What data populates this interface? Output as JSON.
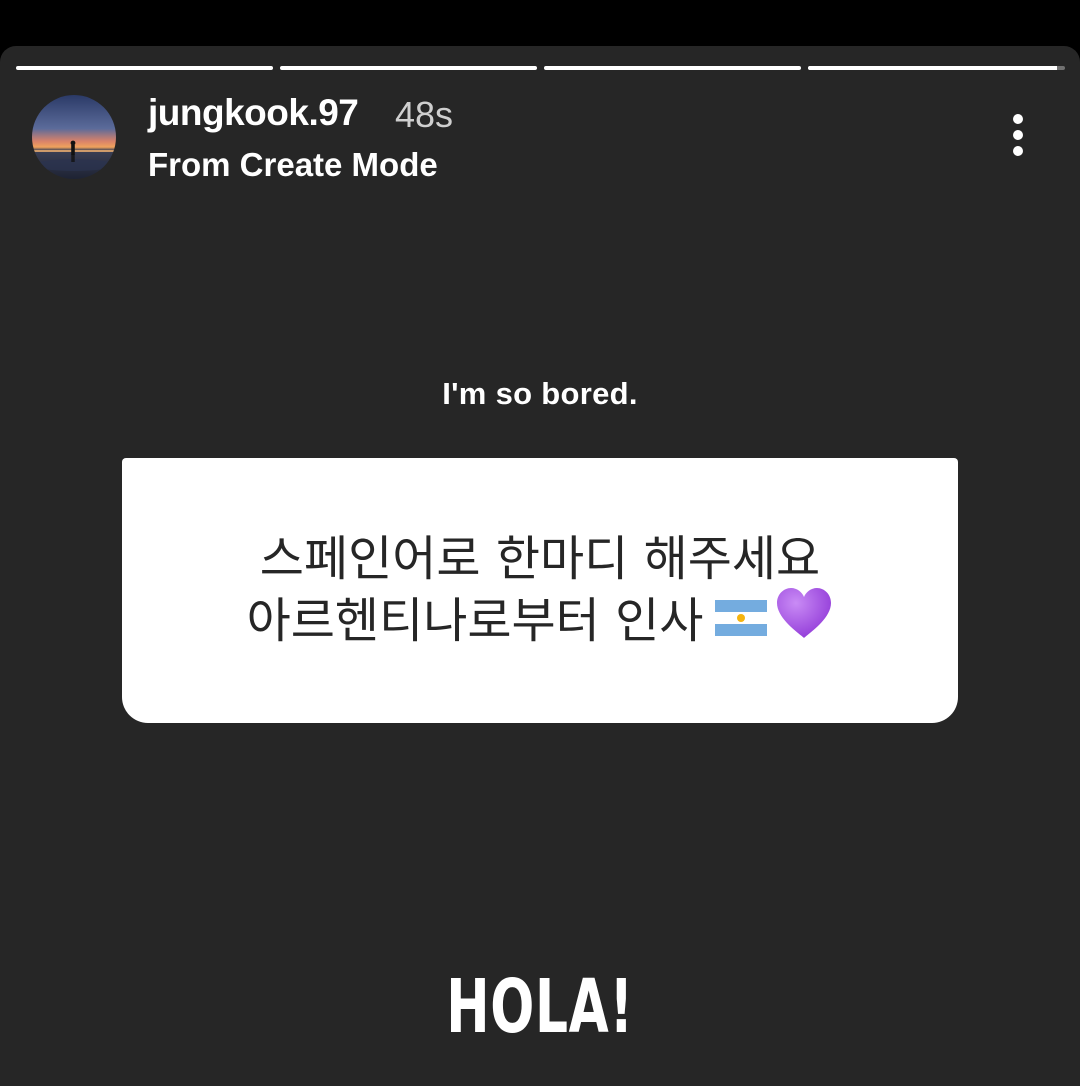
{
  "story": {
    "progress_segments": [
      1.0,
      1.0,
      1.0,
      0.97
    ],
    "user": {
      "username": "jungkook.97",
      "time_ago": "48s",
      "subtitle": "From Create Mode",
      "avatar_icon": "sunset-silhouette-avatar"
    },
    "more_icon": "more-vertical-icon",
    "caption": "I'm so bored.",
    "question": {
      "line1": "스페인어로 한마디 해주세요",
      "line2": "아르헨티나로부터 인사",
      "emoji": [
        "argentina-flag-icon",
        "purple-heart-icon"
      ]
    },
    "answer": "HOLA!"
  },
  "colors": {
    "background": "#262626",
    "card": "#ffffff",
    "text_dark": "#262626",
    "heart": "#a34ce0"
  }
}
